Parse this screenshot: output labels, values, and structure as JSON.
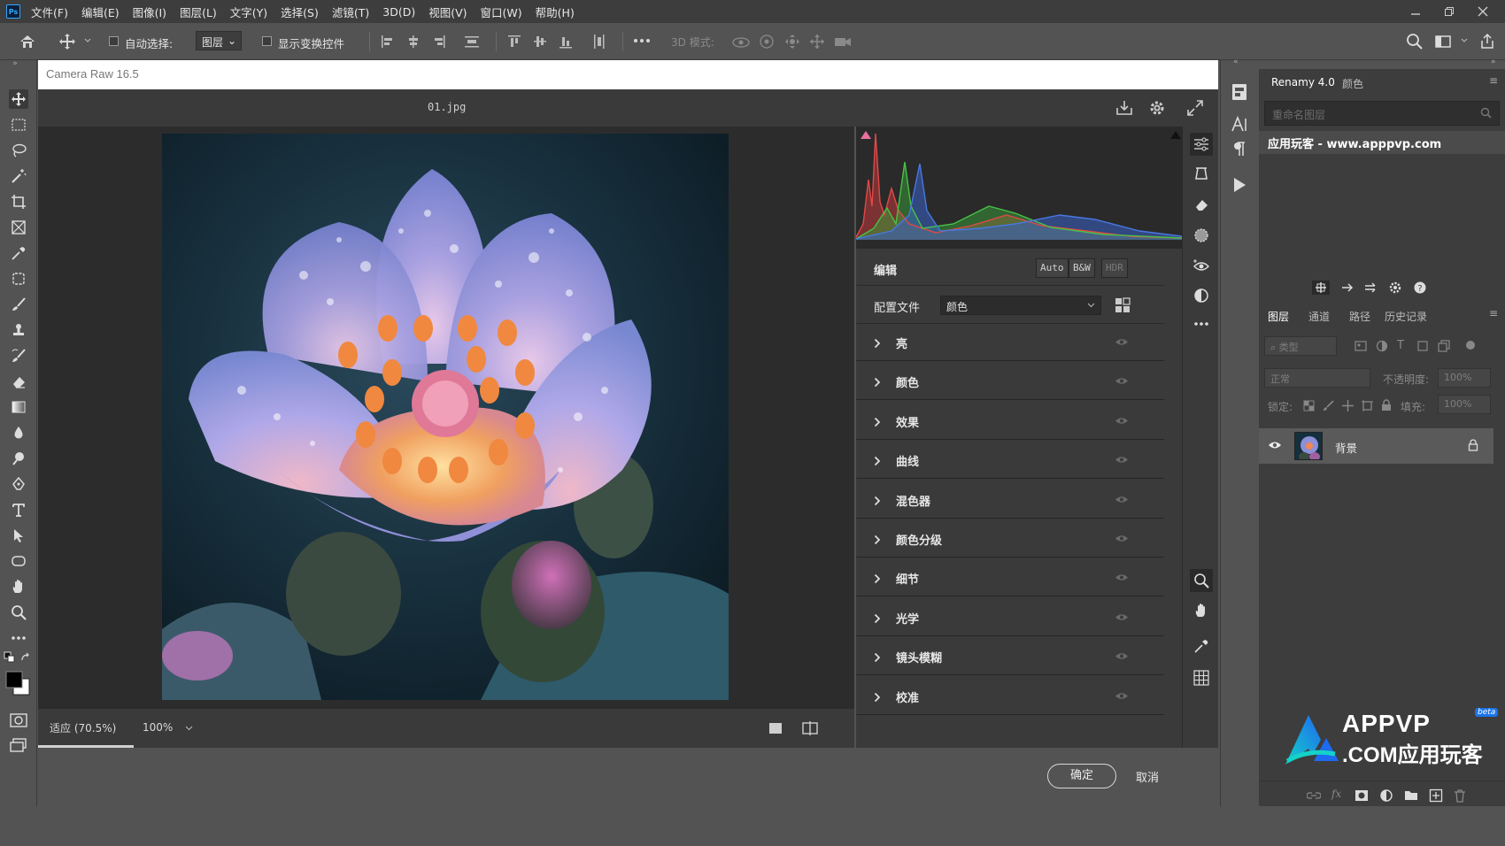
{
  "app": {
    "logo": "Ps"
  },
  "menu": [
    "文件(F)",
    "编辑(E)",
    "图像(I)",
    "图层(L)",
    "文字(Y)",
    "选择(S)",
    "滤镜(T)",
    "3D(D)",
    "视图(V)",
    "窗口(W)",
    "帮助(H)"
  ],
  "options_bar": {
    "auto_select_label": "自动选择:",
    "layer_select_value": "图层",
    "show_transform_label": "显示变换控件",
    "mode_3d_label": "3D 模式:"
  },
  "camera_raw": {
    "title": "Camera Raw 16.5",
    "filename": "01.jpg",
    "edit_title": "编辑",
    "mode_buttons": [
      "Auto",
      "B&W",
      "HDR"
    ],
    "profile_label": "配置文件",
    "profile_value": "颜色",
    "sections": [
      "亮",
      "颜色",
      "效果",
      "曲线",
      "混色器",
      "颜色分级",
      "细节",
      "光学",
      "镜头模糊",
      "校准"
    ],
    "zoom_fit": "适应 (70.5%)",
    "zoom_value": "100%",
    "ok_label": "确定",
    "cancel_label": "取消"
  },
  "renamy": {
    "tabs": [
      "Renamy 4.0",
      "颜色"
    ],
    "search_placeholder": "重命名图层",
    "item": "应用玩客 - www.apppvp.com"
  },
  "layers": {
    "tabs": [
      "图层",
      "通道",
      "路径",
      "历史记录"
    ],
    "kind_label": "类型",
    "blend_mode": "正常",
    "opacity_label": "不透明度:",
    "opacity_value": "100%",
    "lock_label": "锁定:",
    "fill_label": "填充:",
    "fill_value": "100%",
    "background_layer": "背景"
  },
  "watermark": {
    "line1": "APPVP",
    "line2": ".COM应用玩客",
    "badge": "beta"
  },
  "colors": {
    "accent": "#31a8ff",
    "panel_dark": "#3a3a3a",
    "panel_mid": "#535353",
    "histogram_bg": "#2a2a2a"
  }
}
